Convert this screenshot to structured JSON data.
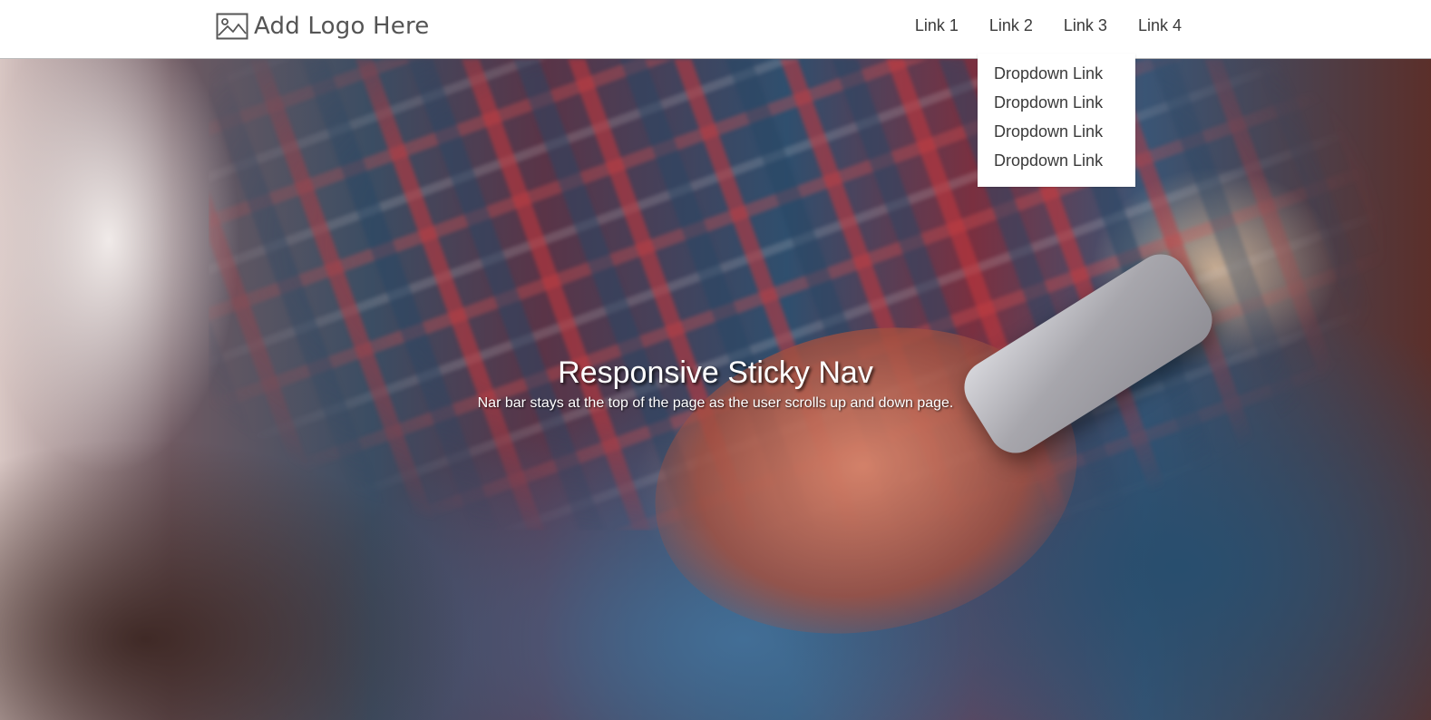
{
  "navbar": {
    "logo": {
      "text": "Add Logo Here",
      "icon": "image-placeholder-icon"
    },
    "links": [
      {
        "label": "Link 1"
      },
      {
        "label": "Link 2"
      },
      {
        "label": "Link 3"
      },
      {
        "label": "Link 4"
      }
    ],
    "dropdown": {
      "items": [
        {
          "label": "Dropdown Link"
        },
        {
          "label": "Dropdown Link"
        },
        {
          "label": "Dropdown Link"
        },
        {
          "label": "Dropdown Link"
        }
      ]
    }
  },
  "hero": {
    "title": "Responsive Sticky Nav",
    "subtitle": "Nar bar stays at the top of the page as the user scrolls up and down page."
  },
  "colors": {
    "navbar_background": "#ffffff",
    "nav_text": "#3a3a3a",
    "logo_text": "#555555",
    "hero_text": "#ffffff"
  }
}
